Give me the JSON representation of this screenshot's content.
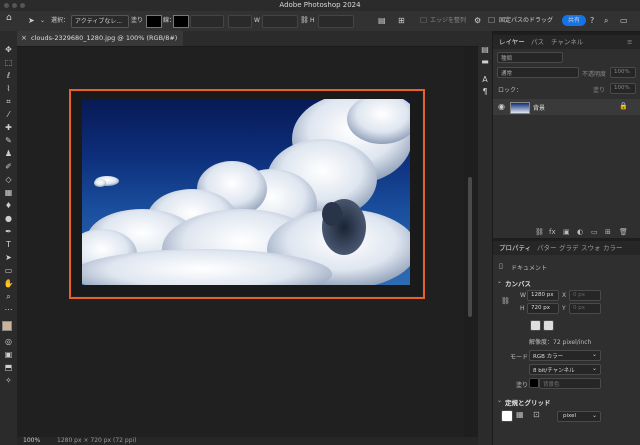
{
  "app": {
    "title": "Adobe Photoshop 2024"
  },
  "options_bar": {
    "select_label": "選択：",
    "select_value": "アクティブなレ...",
    "fill_label": "塗り",
    "stroke_label": "線：",
    "w_label": "W",
    "h_label": "H",
    "edge_label": "エッジを整列",
    "fixed_path_label": "固定パスのドラッグ",
    "share_label": "共有"
  },
  "document": {
    "tab_label": "clouds-2329680_1280.jpg @ 100% (RGB/8#)"
  },
  "status": {
    "zoom": "100%",
    "size": "1280 px × 720 px (72 ppi)"
  },
  "layers_panel": {
    "tabs": [
      "レイヤー",
      "パス",
      "チャンネル"
    ],
    "search_placeholder": "種類",
    "blend_mode": "通常",
    "opacity_label": "不透明度",
    "opacity_value": "100%",
    "lock_label": "ロック：",
    "fill_label": "塗り",
    "fill_value": "100%",
    "layer_name": "背景"
  },
  "properties_panel": {
    "tabs": [
      "プロパティ",
      "パター",
      "グラデ",
      "スウォ",
      "カラー"
    ],
    "doc_label": "ドキュメント",
    "canvas_title": "カンバス",
    "w_label": "W",
    "w_value": "1280 px",
    "h_label": "H",
    "h_value": "720 px",
    "x_label": "X",
    "x_placeholder": "0 px",
    "y_label": "Y",
    "y_placeholder": "0 px",
    "resolution": "解像度：72 pixel/inch",
    "mode_label": "モード",
    "mode_value": "RGB カラー",
    "depth_value": "8 bit/チャンネル",
    "fill_label": "塗り",
    "fill_value": "背景色",
    "guides_title": "定規とグリッド",
    "unit_value": "pixel"
  },
  "colors": {
    "accent": "#1473e6",
    "highlight": "#e8602c"
  }
}
